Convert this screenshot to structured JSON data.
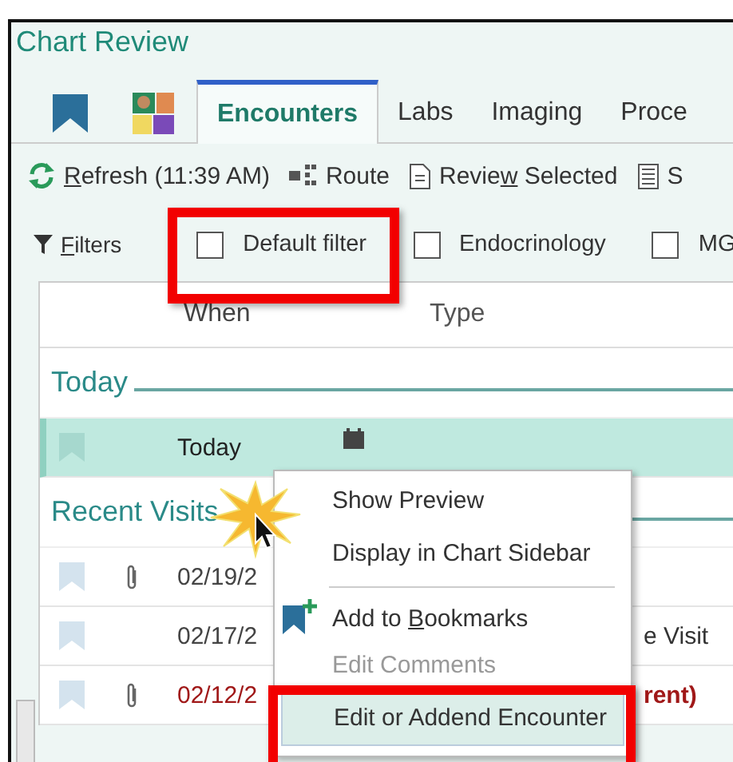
{
  "window": {
    "title": "Chart Review"
  },
  "tabs": [
    {
      "kind": "bookmark",
      "selected": false
    },
    {
      "kind": "patient",
      "selected": false
    },
    {
      "kind": "text",
      "label": "Encounters",
      "selected": true
    },
    {
      "kind": "text",
      "label": "Labs",
      "selected": false
    },
    {
      "kind": "text",
      "label": "Imaging",
      "selected": false
    },
    {
      "kind": "text",
      "label": "Proce",
      "selected": false
    }
  ],
  "toolbar": [
    {
      "kind": "refresh",
      "key": "R",
      "after": "efresh (11:39 AM)"
    },
    {
      "kind": "route",
      "before": "Route"
    },
    {
      "kind": "review",
      "before": "Revie",
      "key": "w",
      "after": " Selected"
    },
    {
      "kind": "list",
      "before": "S"
    }
  ],
  "filters": {
    "key": "F",
    "after": "ilters",
    "checkboxes": [
      {
        "label": "Default filter",
        "checked": false
      },
      {
        "label": "Endocrinology",
        "checked": false
      },
      {
        "label": "MG",
        "checked": false
      }
    ]
  },
  "table": {
    "columns": [
      "When",
      "Type"
    ],
    "groups": [
      {
        "title": "Today",
        "rows": [
          {
            "when": "Today",
            "selected": true,
            "attachment": false,
            "alert": false,
            "kind": "appointment"
          }
        ]
      },
      {
        "title": "Recent Visits",
        "rows": [
          {
            "when": "02/19/2",
            "selected": false,
            "attachment": true,
            "alert": false,
            "kind": "visit"
          },
          {
            "when": "02/17/2",
            "selected": false,
            "attachment": false,
            "alert": false,
            "kind": "visit",
            "type": "e Visit"
          },
          {
            "when": "02/12/2",
            "selected": false,
            "attachment": true,
            "alert": true,
            "kind": "visit",
            "type": "rent)"
          }
        ]
      }
    ]
  },
  "context_menu": {
    "items": [
      {
        "kind": "item",
        "before": "Show Preview",
        "disabled": false,
        "selected": false
      },
      {
        "kind": "item",
        "before": "Display in Chart Sidebar",
        "disabled": false,
        "selected": false
      },
      {
        "kind": "separator"
      },
      {
        "kind": "bookmark",
        "before": "Add to ",
        "key": "B",
        "after": "ookmarks",
        "disabled": false,
        "selected": false
      },
      {
        "kind": "item",
        "before": "Edit Comments",
        "disabled": true,
        "selected": false
      },
      {
        "kind": "item",
        "before": "Edit or Addend Encounter",
        "disabled": false,
        "selected": true
      }
    ]
  }
}
